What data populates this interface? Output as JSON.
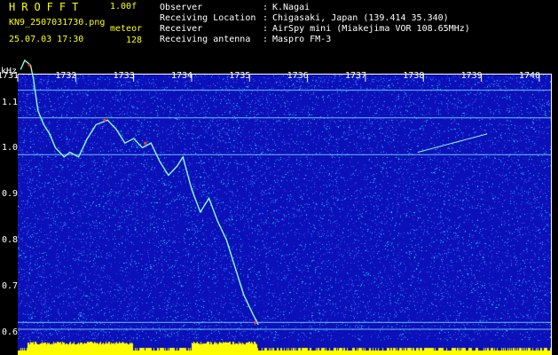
{
  "app": {
    "title": "HROFFT",
    "version": "1.00f",
    "file_name": "KN9_2507031730.png",
    "mode_label": "meteor",
    "date_time": "25.07.03 17:30",
    "mode_value": "128"
  },
  "info": [
    {
      "key": "Observer",
      "value": "K.Nagai"
    },
    {
      "key": "Receiving Location",
      "value": "Chigasaki, Japan (139.414 35.340)"
    },
    {
      "key": "Receiver",
      "value": "AirSpy mini (Miakejima VOR 108.65MHz)"
    },
    {
      "key": "Receiving antenna",
      "value": "Maspro FM-3"
    }
  ],
  "separator": ":",
  "chart_data": {
    "type": "heatmap",
    "ylabel": "kHz",
    "y_ticks": [
      "1.1",
      "1.0",
      "0.9",
      "0.8",
      "0.7",
      "0.6"
    ],
    "x_ticks": [
      "1731",
      "1732",
      "1733",
      "1734",
      "1735",
      "1736",
      "1737",
      "1738",
      "1739",
      "1740"
    ],
    "ylim": [
      0.58,
      1.19
    ],
    "xlim": [
      1731,
      1740.2
    ],
    "reference_lines_khz": [
      1.125,
      1.065,
      0.985,
      0.62,
      0.605
    ],
    "meteor_trace": [
      {
        "x": 1731.05,
        "y": 1.17
      },
      {
        "x": 1731.12,
        "y": 1.19
      },
      {
        "x": 1731.22,
        "y": 1.18
      },
      {
        "x": 1731.27,
        "y": 1.15
      },
      {
        "x": 1731.35,
        "y": 1.08
      },
      {
        "x": 1731.45,
        "y": 1.05
      },
      {
        "x": 1731.55,
        "y": 1.03
      },
      {
        "x": 1731.65,
        "y": 1.0
      },
      {
        "x": 1731.8,
        "y": 0.98
      },
      {
        "x": 1731.9,
        "y": 0.99
      },
      {
        "x": 1732.05,
        "y": 0.98
      },
      {
        "x": 1732.2,
        "y": 1.02
      },
      {
        "x": 1732.35,
        "y": 1.05
      },
      {
        "x": 1732.55,
        "y": 1.06
      },
      {
        "x": 1732.7,
        "y": 1.04
      },
      {
        "x": 1732.85,
        "y": 1.01
      },
      {
        "x": 1733.0,
        "y": 1.02
      },
      {
        "x": 1733.15,
        "y": 1.0
      },
      {
        "x": 1733.3,
        "y": 1.01
      },
      {
        "x": 1733.45,
        "y": 0.97
      },
      {
        "x": 1733.6,
        "y": 0.94
      },
      {
        "x": 1733.75,
        "y": 0.96
      },
      {
        "x": 1733.85,
        "y": 0.98
      },
      {
        "x": 1734.0,
        "y": 0.91
      },
      {
        "x": 1734.15,
        "y": 0.86
      },
      {
        "x": 1734.3,
        "y": 0.89
      },
      {
        "x": 1734.45,
        "y": 0.84
      },
      {
        "x": 1734.6,
        "y": 0.8
      },
      {
        "x": 1734.75,
        "y": 0.74
      },
      {
        "x": 1734.9,
        "y": 0.68
      },
      {
        "x": 1735.05,
        "y": 0.64
      },
      {
        "x": 1735.15,
        "y": 0.615
      }
    ],
    "echo_marks": [
      {
        "x": 1731.2,
        "y": 1.18
      },
      {
        "x": 1732.5,
        "y": 1.06
      },
      {
        "x": 1733.2,
        "y": 1.01
      },
      {
        "x": 1735.1,
        "y": 0.62
      }
    ],
    "secondary_trace": [
      {
        "x": 1737.9,
        "y": 0.99
      },
      {
        "x": 1738.2,
        "y": 1.0
      },
      {
        "x": 1738.5,
        "y": 1.01
      },
      {
        "x": 1738.8,
        "y": 1.02
      },
      {
        "x": 1739.1,
        "y": 1.03
      }
    ],
    "colors": {
      "background": "#0c10b8",
      "noise_light": "#3b6cff",
      "noise_cyan": "#00e8ff",
      "reference_line": "#7fe9ff",
      "trace": "#8cffd2",
      "echo_mark": "#ff3b3b",
      "bottom_bar": "#ffff00"
    }
  }
}
